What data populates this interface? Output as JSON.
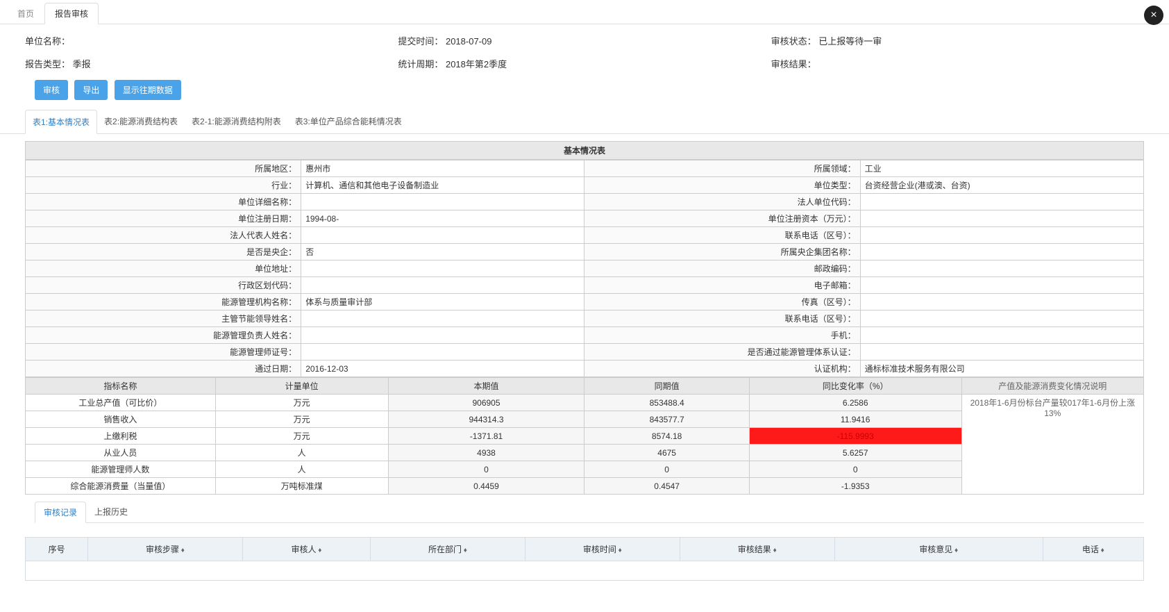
{
  "close_icon": "×",
  "tabs_top": {
    "home": "首页",
    "active": "报告审核"
  },
  "header": {
    "unit_name_label": "单位名称：",
    "unit_name_value": "",
    "submit_time_label": "提交时间：",
    "submit_time_value": "2018-07-09",
    "audit_status_label": "审核状态：",
    "audit_status_value": "已上报等待一审",
    "report_type_label": "报告类型：",
    "report_type_value": "季报",
    "stat_period_label": "统计周期：",
    "stat_period_value": "2018年第2季度",
    "audit_result_label": "审核结果：",
    "audit_result_value": ""
  },
  "buttons": {
    "audit": "审核",
    "export": "导出",
    "show_history": "显示往期数据"
  },
  "sub_tabs": {
    "t1": "表1:基本情况表",
    "t2": "表2:能源消费结构表",
    "t2_1": "表2-1:能源消费结构附表",
    "t3": "表3:单位产品综合能耗情况表"
  },
  "panel_title": "基本情况表",
  "kv_left": [
    {
      "label": "所属地区：",
      "value": "惠州市"
    },
    {
      "label": "行业：",
      "value": "计算机、通信和其他电子设备制造业"
    },
    {
      "label": "单位详细名称：",
      "value": ""
    },
    {
      "label": "单位注册日期：",
      "value": "1994-08-"
    },
    {
      "label": "法人代表人姓名：",
      "value": ""
    },
    {
      "label": "是否是央企：",
      "value": "否"
    },
    {
      "label": "单位地址：",
      "value": ""
    },
    {
      "label": "行政区划代码：",
      "value": ""
    },
    {
      "label": "能源管理机构名称：",
      "value": "体系与质量审计部"
    },
    {
      "label": "主管节能领导姓名：",
      "value": ""
    },
    {
      "label": "能源管理负责人姓名：",
      "value": ""
    },
    {
      "label": "能源管理师证号：",
      "value": ""
    },
    {
      "label": "通过日期：",
      "value": "2016-12-03"
    }
  ],
  "kv_right": [
    {
      "label": "所属领域：",
      "value": "工业"
    },
    {
      "label": "单位类型：",
      "value": "台资经营企业(港或澳、台资)"
    },
    {
      "label": "法人单位代码：",
      "value": ""
    },
    {
      "label": "单位注册资本（万元）：",
      "value": ""
    },
    {
      "label": "联系电话（区号）：",
      "value": ""
    },
    {
      "label": "所属央企集团名称：",
      "value": ""
    },
    {
      "label": "邮政编码：",
      "value": ""
    },
    {
      "label": "电子邮箱：",
      "value": ""
    },
    {
      "label": "传真（区号）：",
      "value": ""
    },
    {
      "label": "联系电话（区号）：",
      "value": ""
    },
    {
      "label": "手机：",
      "value": ""
    },
    {
      "label": "是否通过能源管理体系认证：",
      "value": ""
    },
    {
      "label": "认证机构：",
      "value": "通标标准技术服务有限公司"
    }
  ],
  "ind_headers": {
    "name": "指标名称",
    "unit": "计量单位",
    "cur": "本期值",
    "prev": "同期值",
    "chg": "同比变化率（%）",
    "note": "产值及能源消费变化情况说明"
  },
  "ind_rows": [
    {
      "name": "工业总产值（可比价）",
      "unit": "万元",
      "cur": "906905",
      "prev": "853488.4",
      "chg": "6.2586"
    },
    {
      "name": "销售收入",
      "unit": "万元",
      "cur": "944314.3",
      "prev": "843577.7",
      "chg": "11.9416"
    },
    {
      "name": "上缴利税",
      "unit": "万元",
      "cur": "-1371.81",
      "prev": "8574.18",
      "chg": "-115.9993"
    },
    {
      "name": "从业人员",
      "unit": "人",
      "cur": "4938",
      "prev": "4675",
      "chg": "5.6257"
    },
    {
      "name": "能源管理师人数",
      "unit": "人",
      "cur": "0",
      "prev": "0",
      "chg": "0"
    },
    {
      "name": "综合能源消费量（当量值）",
      "unit": "万吨标准煤",
      "cur": "0.4459",
      "prev": "0.4547",
      "chg": "-1.9353"
    }
  ],
  "note_text": "2018年1-6月份标台产量较017年1-6月份上涨13%",
  "bottom_tabs": {
    "records": "审核记录",
    "history": "上报历史"
  },
  "audit_headers": {
    "seq": "序号",
    "step": "审核步骤",
    "person": "审核人",
    "dept": "所在部门",
    "time": "审核时间",
    "result": "审核结果",
    "opinion": "审核意见",
    "phone": "电话"
  }
}
